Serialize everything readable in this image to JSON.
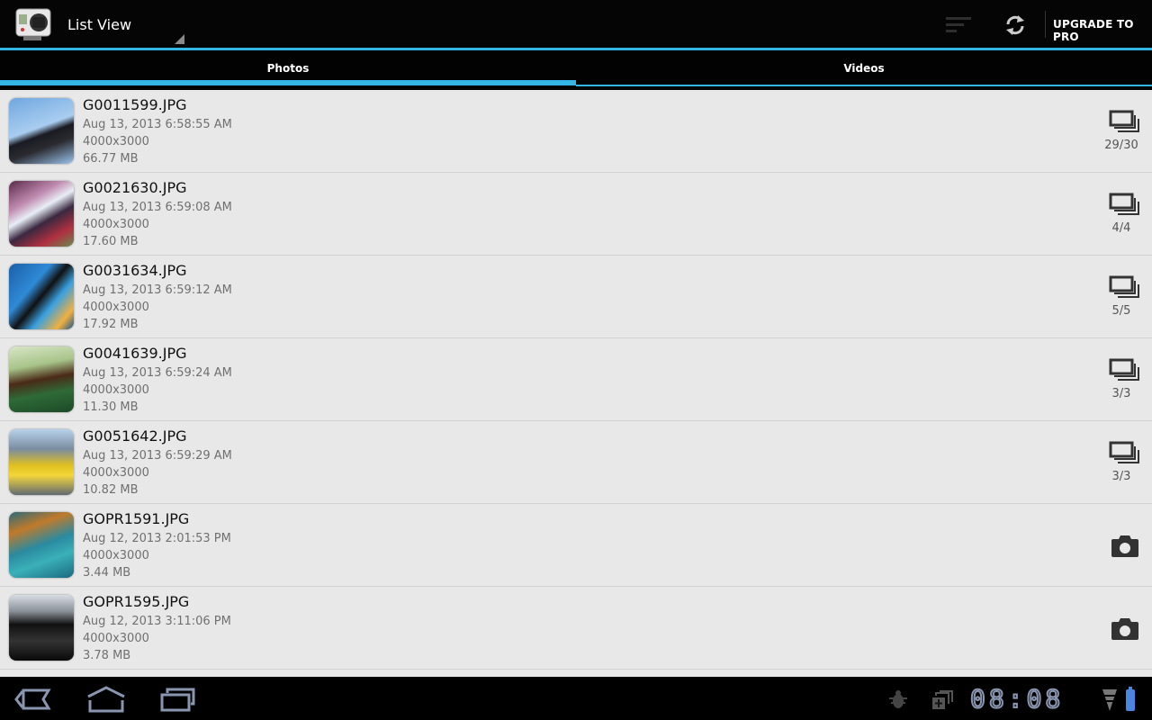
{
  "action_bar": {
    "app_icon": "gopro-camera-icon",
    "title": "List View",
    "sort_icon": "sort-icon",
    "refresh_icon": "refresh-icon",
    "upgrade_label": "UPGRADE TO PRO"
  },
  "tabs": [
    {
      "label": "Photos",
      "selected": true
    },
    {
      "label": "Videos",
      "selected": false
    }
  ],
  "colors": {
    "accent": "#33b5e5",
    "list_background": "#e8e8e8",
    "action_bar": "#050505"
  },
  "items": [
    {
      "name": "G0011599.JPG",
      "date": "Aug 13, 2013 6:58:55 AM",
      "resolution": "4000x3000",
      "size": "66.77 MB",
      "type": "burst",
      "count": "29/30",
      "thumb": "skydiving-tandem"
    },
    {
      "name": "G0021630.JPG",
      "date": "Aug 13, 2013 6:59:08 AM",
      "resolution": "4000x3000",
      "size": "17.60 MB",
      "type": "burst",
      "count": "4/4",
      "thumb": "skydiver-goggles"
    },
    {
      "name": "G0031634.JPG",
      "date": "Aug 13, 2013 6:59:12 AM",
      "resolution": "4000x3000",
      "size": "17.92 MB",
      "type": "burst",
      "count": "5/5",
      "thumb": "skydiver-blue-sky"
    },
    {
      "name": "G0041639.JPG",
      "date": "Aug 13, 2013 6:59:24 AM",
      "resolution": "4000x3000",
      "size": "11.30 MB",
      "type": "burst",
      "count": "3/3",
      "thumb": "mountain-paraglide"
    },
    {
      "name": "G0051642.JPG",
      "date": "Aug 13, 2013 6:59:29 AM",
      "resolution": "4000x3000",
      "size": "10.82 MB",
      "type": "burst",
      "count": "3/3",
      "thumb": "ski-legs"
    },
    {
      "name": "GOPR1591.JPG",
      "date": "Aug 12, 2013 2:01:53 PM",
      "resolution": "4000x3000",
      "size": "3.44 MB",
      "type": "single",
      "count": "",
      "thumb": "sea-turtle"
    },
    {
      "name": "GOPR1595.JPG",
      "date": "Aug 12, 2013 3:11:06 PM",
      "resolution": "4000x3000",
      "size": "3.78 MB",
      "type": "single",
      "count": "",
      "thumb": "car-interior"
    }
  ],
  "system_bar": {
    "back_icon": "back-icon",
    "home_icon": "home-icon",
    "recent_icon": "recent-apps-icon",
    "debug_icon": "bug-icon",
    "notification_icon": "stacked-windows-icon",
    "time": "08:08",
    "wifi_icon": "wifi-icon",
    "battery_icon": "battery-icon"
  }
}
